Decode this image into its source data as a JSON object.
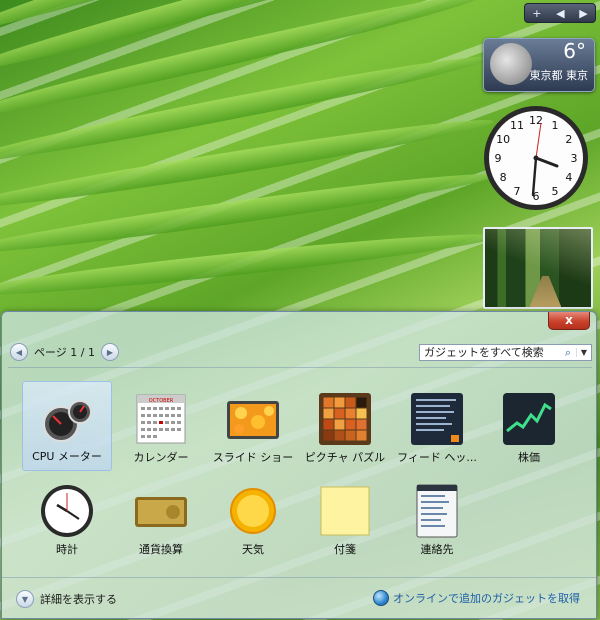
{
  "sidebar": {
    "controls": {
      "add": "+",
      "prev": "◀",
      "next": "▶"
    },
    "weather": {
      "temperature": "6°",
      "location": "東京都 東京"
    },
    "clock": {
      "numbers": [
        "12",
        "1",
        "2",
        "3",
        "4",
        "5",
        "6",
        "7",
        "8",
        "9",
        "10",
        "11"
      ]
    }
  },
  "gallery": {
    "close": "x",
    "pager": {
      "prev": "◀",
      "label": "ページ 1 / 1",
      "next": "▶"
    },
    "search": {
      "placeholder": "ガジェットをすべて検索"
    },
    "gadgets": [
      {
        "label": "CPU メーター",
        "icon": "cpu-meter-icon"
      },
      {
        "label": "カレンダー",
        "icon": "calendar-icon"
      },
      {
        "label": "スライド ショー",
        "icon": "slideshow-icon"
      },
      {
        "label": "ピクチャ パズル",
        "icon": "picture-puzzle-icon"
      },
      {
        "label": "フィード ヘッ...",
        "icon": "feed-headlines-icon"
      },
      {
        "label": "株価",
        "icon": "stocks-icon"
      },
      {
        "label": "時計",
        "icon": "clock-icon"
      },
      {
        "label": "通貨換算",
        "icon": "currency-icon"
      },
      {
        "label": "天気",
        "icon": "weather-icon"
      },
      {
        "label": "付箋",
        "icon": "sticky-note-icon"
      },
      {
        "label": "連絡先",
        "icon": "contacts-icon"
      }
    ],
    "calendar_month": "OCTOBER",
    "footer": {
      "details": "詳細を表示する",
      "online": "オンラインで追加のガジェットを取得"
    }
  },
  "colors": {
    "accent": "#1e5fa8",
    "close_red": "#c8422c",
    "wallpaper_green": "#5ea628"
  }
}
